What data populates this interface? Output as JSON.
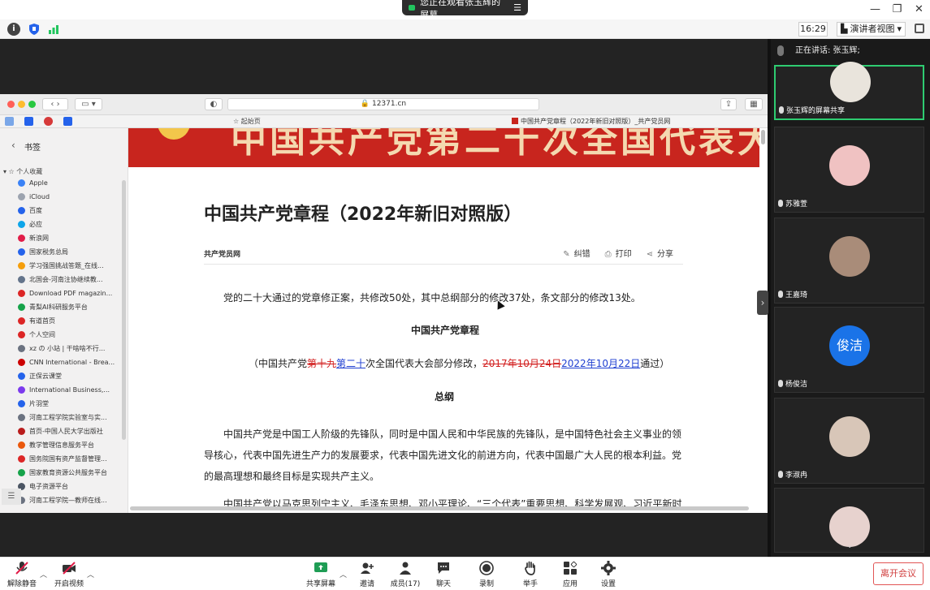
{
  "zoom": {
    "share_notice": "您正在观看张玉辉的屏幕",
    "time": "16:29",
    "view_mode": "演讲者视图",
    "speaking": "正在讲话: 张玉辉;",
    "leave_label": "离开会议",
    "toolbar": {
      "mute": "解除静音",
      "video": "开启视频",
      "share": "共享屏幕",
      "invite": "邀请",
      "participants": "成员(17)",
      "chat": "聊天",
      "record": "录制",
      "raise_hand": "举手",
      "apps": "应用",
      "settings": "设置"
    },
    "participants": [
      {
        "name": "张玉辉的屏幕共享",
        "avatar_color": "#e9e4dc",
        "active": true
      },
      {
        "name": "苏雅萱",
        "avatar_color": "#f0c2c2"
      },
      {
        "name": "王嘉琦",
        "avatar_color": "#a98c79"
      },
      {
        "name": "杨俊洁",
        "avatar_text": "俊洁",
        "avatar_color": "#1a73e8"
      },
      {
        "name": "李淑冉",
        "avatar_color": "#d8c6b8"
      },
      {
        "name": "",
        "avatar_color": "#e7d2ce"
      }
    ]
  },
  "browser": {
    "url": "12371.cn",
    "tab1": "起始页",
    "tab2": "中国共产党章程（2022年新旧对照版）_共产党员网",
    "sidebar": {
      "title": "书签",
      "group": "个人收藏",
      "items": [
        {
          "label": "Apple",
          "color": "#3b82f6"
        },
        {
          "label": "iCloud",
          "color": "#9ca3af"
        },
        {
          "label": "百度",
          "color": "#2563eb"
        },
        {
          "label": "必应",
          "color": "#0ea5e9"
        },
        {
          "label": "新浪网",
          "color": "#e11d48"
        },
        {
          "label": "国家税务总局",
          "color": "#2563eb"
        },
        {
          "label": "学习强国挑战答题_在线...",
          "color": "#f59e0b"
        },
        {
          "label": "北国会-河南注协继续教...",
          "color": "#64748b"
        },
        {
          "label": "Download PDF magazin...",
          "color": "#dc2626"
        },
        {
          "label": "青梨AI科研服务平台",
          "color": "#16a34a"
        },
        {
          "label": "有道首页",
          "color": "#dc2626"
        },
        {
          "label": "个人空间",
          "color": "#dc2626"
        },
        {
          "label": "xz の 小站 | 干啥啥不行...",
          "color": "#6b7280"
        },
        {
          "label": "CNN International - Brea...",
          "color": "#cc0000"
        },
        {
          "label": "正保云课堂",
          "color": "#2563eb"
        },
        {
          "label": "International Business,...",
          "color": "#7c3aed"
        },
        {
          "label": "片羽堂",
          "color": "#2563eb"
        },
        {
          "label": "河南工程学院实验室与实...",
          "color": "#6b7280"
        },
        {
          "label": "首页-中国人民大学出版社",
          "color": "#b91c1c"
        },
        {
          "label": "教学管理信息服务平台",
          "color": "#ea580c"
        },
        {
          "label": "国务院国有资产监督管理...",
          "color": "#dc2626"
        },
        {
          "label": "国家教育资源公共服务平台",
          "color": "#16a34a"
        },
        {
          "label": "电子资源平台",
          "color": "#4b5563"
        },
        {
          "label": "河南工程学院—教师在线...",
          "color": "#6b7280"
        }
      ]
    },
    "article": {
      "banner_text": "中国共产党第二十次全国代表大会",
      "title": "中国共产党章程（2022年新旧对照版）",
      "source": "共产党员网",
      "actions": {
        "report": "纠错",
        "print": "打印",
        "share": "分享"
      },
      "p1": "党的二十大通过的党章修正案，共修改50处，其中总纲部分的修改37处，条文部分的修改13处。",
      "p2": "中国共产党章程",
      "p3": {
        "a": "（中国共产党",
        "del1": "第十九",
        "ins1": "第二十",
        "b": "次全国代表大会部分修改，",
        "del2": "2017年10月24日",
        "ins2": "2022年10月22日",
        "c": "通过）"
      },
      "p4": "总纲",
      "p5": "中国共产党是中国工人阶级的先锋队，同时是中国人民和中华民族的先锋队，是中国特色社会主义事业的领导核心，代表中国先进生产力的发展要求，代表中国先进文化的前进方向，代表中国最广大人民的根本利益。党的最高理想和最终目标是实现共产主义。",
      "p6": "中国共产党以马克思列宁主义、毛泽东思想、邓小平理论、“三个代表”重要思想、科学发展观、习近平新时"
    }
  }
}
